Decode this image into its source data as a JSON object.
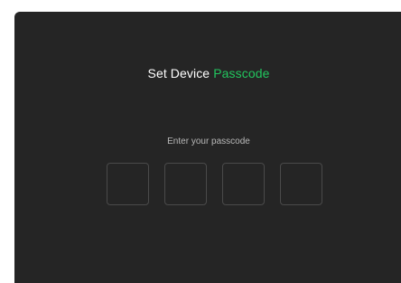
{
  "dialog": {
    "title_prefix": "Set Device",
    "title_accent": "Passcode",
    "hint": "Enter your passcode",
    "passcode_digits": [
      "",
      "",
      "",
      ""
    ]
  },
  "colors": {
    "background": "#252525",
    "accent": "#22c55e",
    "box_border": "#4a4a4a"
  }
}
